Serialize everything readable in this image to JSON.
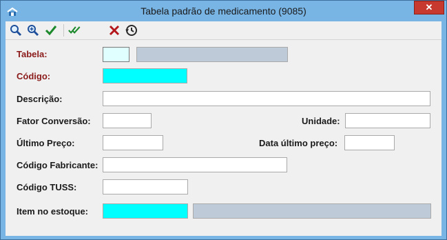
{
  "window": {
    "title": "Tabela padrão de medicamento (9085)",
    "close_label": "✕"
  },
  "toolbar": {
    "buttons": [
      {
        "name": "search-icon",
        "label": ""
      },
      {
        "name": "search-plus-icon",
        "label": ""
      },
      {
        "name": "check-icon",
        "label": ""
      },
      {
        "name": "double-check-icon",
        "label": ""
      },
      {
        "name": "cancel-icon",
        "label": ""
      },
      {
        "name": "history-icon",
        "label": ""
      }
    ]
  },
  "form": {
    "tabela": {
      "label": "Tabela:",
      "value": "",
      "desc": ""
    },
    "codigo": {
      "label": "Código:",
      "value": ""
    },
    "descricao": {
      "label": "Descrição:",
      "value": ""
    },
    "fator_conversao": {
      "label": "Fator Conversão:",
      "value": ""
    },
    "unidade": {
      "label": "Unidade:",
      "value": ""
    },
    "ultimo_preco": {
      "label": "Último Preço:",
      "value": ""
    },
    "data_ultimo_preco": {
      "label": "Data último preço:",
      "value": ""
    },
    "codigo_fabricante": {
      "label": "Código Fabricante:",
      "value": ""
    },
    "codigo_tuss": {
      "label": "Código TUSS:",
      "value": ""
    },
    "item_estoque": {
      "label": "Item no estoque:",
      "value": "",
      "desc": ""
    }
  },
  "colors": {
    "title_bg": "#78b4e4",
    "required_label": "#8b1a1a",
    "cyan_field": "#00ffff",
    "readonly_field": "#bfcad8",
    "close_btn": "#c7382f"
  }
}
